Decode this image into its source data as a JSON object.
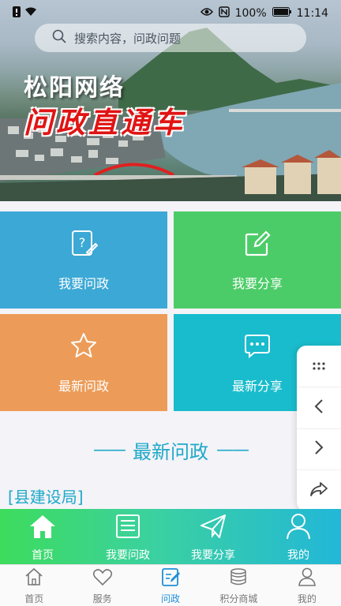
{
  "status_bar": {
    "battery": "100%",
    "time": "11:14"
  },
  "search": {
    "placeholder": "搜索内容，问政问题"
  },
  "banner": {
    "title_line1": "松阳网络",
    "title_line2": "问政直通车"
  },
  "tiles": [
    {
      "label": "我要问政",
      "icon": "question-edit-icon",
      "color": "#3ca8d5"
    },
    {
      "label": "我要分享",
      "icon": "edit-square-icon",
      "color": "#4ccc68"
    },
    {
      "label": "最新问政",
      "icon": "star-icon",
      "color": "#ec9c58"
    },
    {
      "label": "最新分享",
      "icon": "chat-dots-icon",
      "color": "#19bccc"
    }
  ],
  "section": {
    "dash_left": "——",
    "title": "最新问政",
    "dash_right": "——"
  },
  "category_label": "[县建设局]",
  "quick_bar": [
    {
      "label": "首页",
      "icon": "home-icon"
    },
    {
      "label": "我要问政",
      "icon": "document-icon"
    },
    {
      "label": "我要分享",
      "icon": "paper-plane-icon"
    },
    {
      "label": "我的",
      "icon": "user-icon"
    }
  ],
  "nav": [
    {
      "label": "首页",
      "icon": "home-outline-icon"
    },
    {
      "label": "服务",
      "icon": "heart-icon"
    },
    {
      "label": "问政",
      "icon": "edit-icon",
      "active": true
    },
    {
      "label": "积分商城",
      "icon": "coins-icon"
    },
    {
      "label": "我的",
      "icon": "user-outline-icon"
    }
  ],
  "colors": {
    "accent": "#1ea9c8",
    "nav_active": "#1f8fd8"
  }
}
